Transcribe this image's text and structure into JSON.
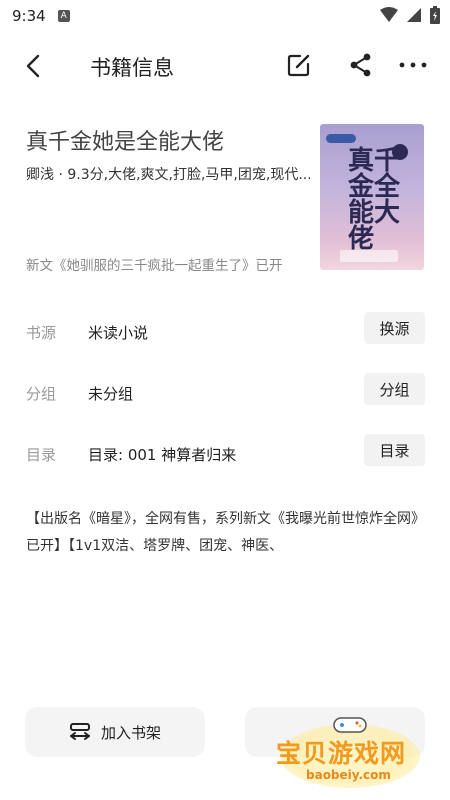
{
  "status_bar": {
    "time": "9:34",
    "notification_letter": "A"
  },
  "header": {
    "title": "书籍信息"
  },
  "book": {
    "title": "真千金她是全能大佬",
    "meta": "卿浅 · 9.3分,大佬,爽文,打脸,马甲,团宠,现代...",
    "latest": "新文《她驯服的三千疯批一起重生了》已开",
    "cover_title": "真千金全能大佬"
  },
  "rows": [
    {
      "label": "书源",
      "value": "米读小说",
      "button": "换源"
    },
    {
      "label": "分组",
      "value": "未分组",
      "button": "分组"
    },
    {
      "label": "目录",
      "value": "目录: 001 神算者归来",
      "button": "目录"
    }
  ],
  "description": "【出版名《暗星》，全网有售，系列新文《我曝光前世惊炸全网》已开】【1v1双洁、塔罗牌、团宠、神医、",
  "bottom": {
    "add_shelf": "加入书架"
  },
  "watermark": {
    "text": "宝贝游戏网",
    "url": "baobeiy.com"
  },
  "icons": {
    "back": "chevron-left-icon",
    "edit": "edit-icon",
    "share": "share-icon",
    "more": "more-dots-icon",
    "shelf": "bookshelf-icon",
    "wifi": "wifi-icon",
    "signal": "signal-icon",
    "battery": "battery-icon"
  },
  "colors": {
    "accent": "#f29a1d",
    "button_bg": "#f2f2f2",
    "label_gray": "#999999"
  }
}
